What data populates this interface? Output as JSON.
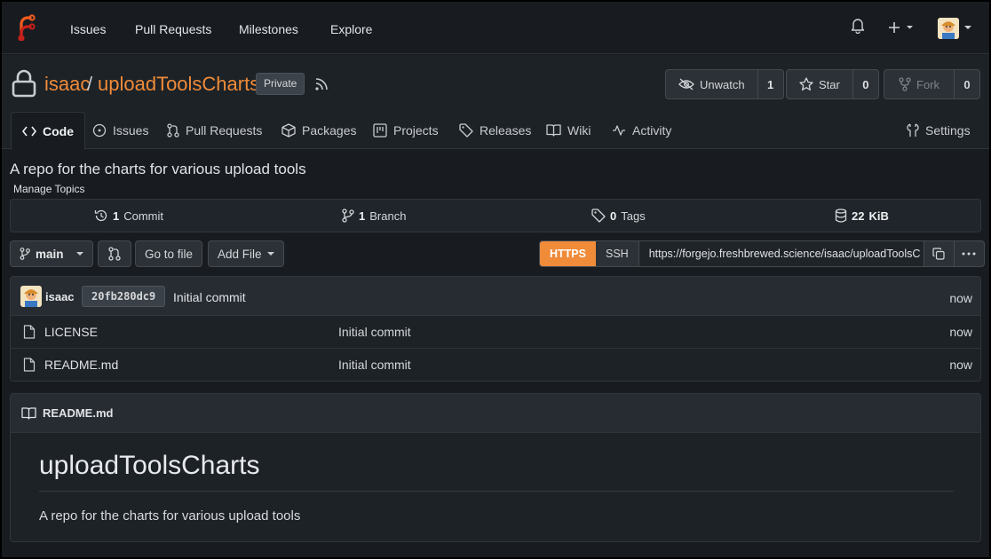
{
  "nav": {
    "items": [
      "Issues",
      "Pull Requests",
      "Milestones",
      "Explore"
    ]
  },
  "repo": {
    "owner": "isaac",
    "separator": "/",
    "name": "uploadToolsCharts",
    "visibility": "Private",
    "watch_label": "Unwatch",
    "watch_count": "1",
    "star_label": "Star",
    "star_count": "0",
    "fork_label": "Fork",
    "fork_count": "0"
  },
  "tabs": {
    "code": "Code",
    "issues": "Issues",
    "pulls": "Pull Requests",
    "packages": "Packages",
    "projects": "Projects",
    "releases": "Releases",
    "wiki": "Wiki",
    "activity": "Activity",
    "settings": "Settings"
  },
  "description": "A repo for the charts for various upload tools",
  "manage_topics": "Manage Topics",
  "stats": {
    "commits_num": "1",
    "commits_label": "Commit",
    "branches_num": "1",
    "branches_label": "Branch",
    "tags_num": "0",
    "tags_label": "Tags",
    "size_num": "22",
    "size_label": "KiB"
  },
  "actions": {
    "branch": "main",
    "go_to_file": "Go to file",
    "add_file": "Add File",
    "https": "HTTPS",
    "ssh": "SSH",
    "clone_url": "https://forgejo.freshbrewed.science/isaac/uploadToolsC"
  },
  "latest_commit": {
    "author": "isaac",
    "sha": "20fb280dc9",
    "message": "Initial commit",
    "age": "now"
  },
  "files": [
    {
      "name": "LICENSE",
      "message": "Initial commit",
      "age": "now"
    },
    {
      "name": "README.md",
      "message": "Initial commit",
      "age": "now"
    }
  ],
  "readme": {
    "filename": "README.md",
    "heading": "uploadToolsCharts",
    "body": "A repo for the charts for various upload tools"
  },
  "colors": {
    "accent": "#f08b3a",
    "background": "#181c21"
  }
}
